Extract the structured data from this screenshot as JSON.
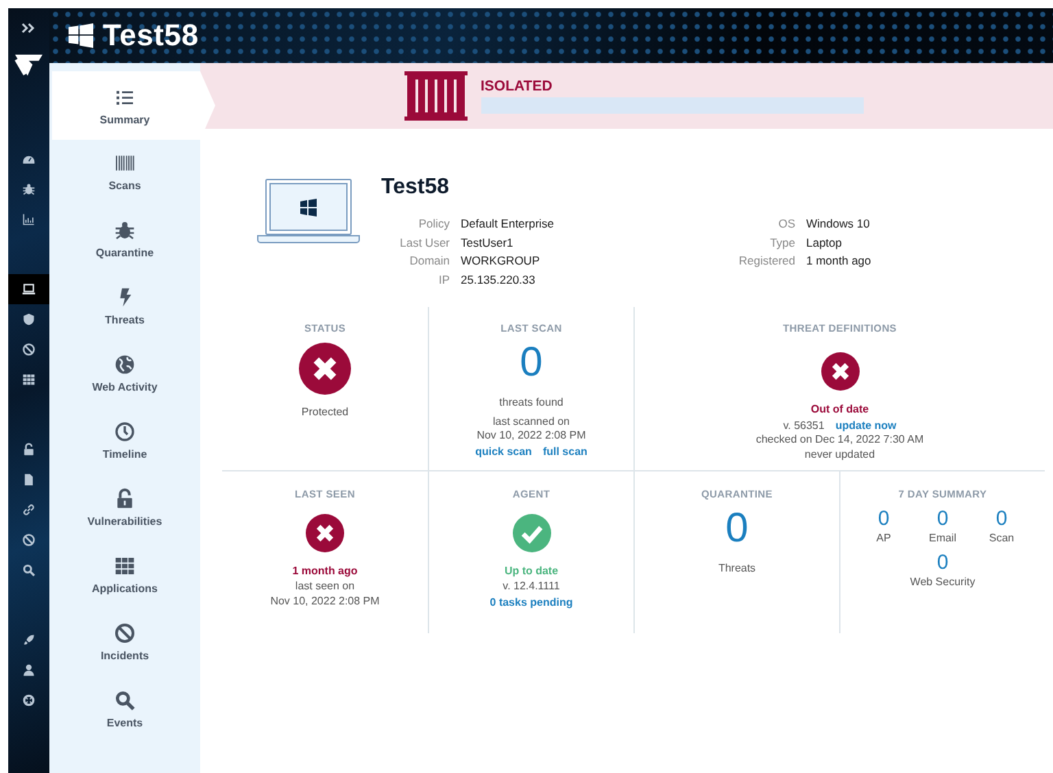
{
  "header": {
    "title": "Test58"
  },
  "rail": {
    "groups": [
      {
        "items": [
          {
            "selected": false
          },
          {
            "selected": false
          },
          {
            "selected": false
          }
        ]
      },
      {
        "items": [
          {
            "selected": true
          },
          {
            "selected": false
          },
          {
            "selected": false
          },
          {
            "selected": false
          }
        ]
      },
      {
        "items": [
          {
            "selected": false
          },
          {
            "selected": false
          },
          {
            "selected": false
          },
          {
            "selected": false
          },
          {
            "selected": false
          }
        ]
      },
      {
        "items": [
          {
            "selected": false
          },
          {
            "selected": false
          },
          {
            "selected": false
          }
        ]
      }
    ]
  },
  "sidebar": {
    "items": [
      {
        "label": "Summary",
        "selected": true
      },
      {
        "label": "Scans",
        "selected": false
      },
      {
        "label": "Quarantine",
        "selected": false
      },
      {
        "label": "Threats",
        "selected": false
      },
      {
        "label": "Web Activity",
        "selected": false
      },
      {
        "label": "Timeline",
        "selected": false
      },
      {
        "label": "Vulnerabilities",
        "selected": false
      },
      {
        "label": "Applications",
        "selected": false
      },
      {
        "label": "Incidents",
        "selected": false
      },
      {
        "label": "Events",
        "selected": false
      }
    ]
  },
  "banner": {
    "status": "ISOLATED"
  },
  "device": {
    "name": "Test58",
    "details_left": [
      {
        "label": "Policy",
        "value": "Default Enterprise"
      },
      {
        "label": "Last User",
        "value": "TestUser1"
      },
      {
        "label": "Domain",
        "value": "WORKGROUP"
      },
      {
        "label": "IP",
        "value": "25.135.220.33"
      }
    ],
    "details_right": [
      {
        "label": "OS",
        "value": "Windows 10"
      },
      {
        "label": "Type",
        "value": "Laptop"
      },
      {
        "label": "Registered",
        "value": "1 month ago"
      }
    ]
  },
  "card_rows": [
    [
      {
        "title": "STATUS",
        "blocks": [
          {
            "kind": "big-icon",
            "passed": false
          },
          {
            "kind": "text",
            "text": "Protected"
          }
        ]
      },
      {
        "title": "LAST SCAN",
        "blocks": [
          {
            "kind": "count",
            "text": "0"
          },
          {
            "kind": "text",
            "text": "threats found"
          },
          {
            "kind": "gap"
          },
          {
            "kind": "text",
            "text": "last scanned on"
          },
          {
            "kind": "text",
            "text": "Nov 10, 2022 2:08 PM"
          },
          {
            "kind": "group",
            "items": [
              {
                "kind": "link",
                "text": "quick scan"
              },
              {
                "kind": "link",
                "text": "full scan"
              }
            ]
          }
        ]
      },
      {
        "title": "THREAT DEFINITIONS",
        "blocks": [
          {
            "kind": "icon",
            "passed": false
          },
          {
            "kind": "note",
            "passed": false,
            "text": "Out of date"
          },
          {
            "kind": "group",
            "items": [
              {
                "kind": "text",
                "text": "v. 56351"
              },
              {
                "kind": "link",
                "text": "update now"
              }
            ]
          },
          {
            "kind": "text",
            "text": "checked on Dec 14, 2022 7:30 AM"
          },
          {
            "kind": "text",
            "text": "never updated"
          }
        ]
      }
    ],
    [
      {
        "title": "LAST SEEN",
        "blocks": [
          {
            "kind": "icon",
            "passed": false
          },
          {
            "kind": "note",
            "passed": false,
            "text": "1 month ago"
          },
          {
            "kind": "text",
            "text": "last seen on"
          },
          {
            "kind": "text",
            "text": "Nov 10, 2022 2:08 PM"
          }
        ]
      },
      {
        "title": "AGENT",
        "blocks": [
          {
            "kind": "icon",
            "passed": true
          },
          {
            "kind": "note",
            "passed": true,
            "text": "Up to date"
          },
          {
            "kind": "text",
            "text": "v. 12.4.1111"
          },
          {
            "kind": "link",
            "text": "0 tasks pending"
          }
        ]
      },
      {
        "title": "QUARANTINE",
        "blocks": [
          {
            "kind": "count",
            "text": "0"
          },
          {
            "kind": "text",
            "text": "Threats"
          }
        ]
      },
      {
        "title": "7 DAY SUMMARY",
        "blocks": [
          {
            "kind": "stats",
            "items": [
              {
                "count": "0",
                "label": "AP"
              },
              {
                "count": "0",
                "label": "Email"
              },
              {
                "count": "0",
                "label": "Scan"
              }
            ]
          },
          {
            "kind": "stats",
            "items": [
              {
                "count": "0",
                "label": "Web Security"
              }
            ]
          }
        ]
      }
    ]
  ]
}
